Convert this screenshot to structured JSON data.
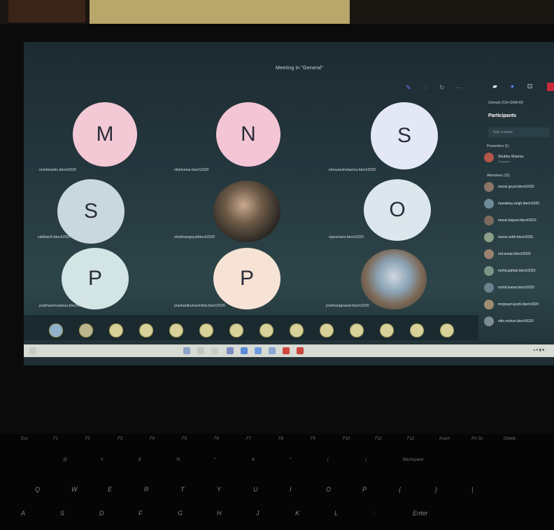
{
  "meeting": {
    "title": "Meeting in \"General\""
  },
  "tiles": [
    {
      "initial": "M",
      "type": "initial",
      "color": "#f3c9d6",
      "name": "mohitmahto.btech2020"
    },
    {
      "initial": "N",
      "type": "initial",
      "color": "#f4c5d4",
      "name": "nitinkumar.btech2020"
    },
    {
      "initial": "S",
      "type": "initial",
      "color": "#e4e8f6",
      "name": "shreyanshsharma.btech2020"
    },
    {
      "initial": "S",
      "type": "initial",
      "color": "#c9d8dd",
      "name": "siddharth.btech2020"
    },
    {
      "initial": "",
      "type": "photo",
      "color": "",
      "name": "shubhamgoyalbtech2020"
    },
    {
      "initial": "O",
      "type": "initial",
      "color": "#dbe7ec",
      "name": "ojasvisaini.btech2020"
    },
    {
      "initial": "P",
      "type": "initial",
      "color": "#d3e4e4",
      "name": "prakharsrivastava.btech2020"
    },
    {
      "initial": "P",
      "type": "initial",
      "color": "#f7e3d6",
      "name": "prashantkumarmittal.btech2020"
    },
    {
      "initial": "",
      "type": "photo2",
      "color": "",
      "name": "prakharagrawal.btech2020"
    }
  ],
  "panel": {
    "hint": "Unmute (Ctrl+Shift+M)",
    "title": "Participants",
    "search_placeholder": "Type a name",
    "presenters_label": "Presenters (1)",
    "presenter": {
      "name": "Shubha Sharma",
      "role": "Organizer"
    },
    "attendees_label": "Attendees (33)",
    "attendees": [
      "mansi.goyal.btech2020",
      "mandeep.singh.btech2020",
      "mansi.kapoor.btech2020",
      "manvi.sethi.btech2020",
      "md.ansari.btech2020",
      "mohit.pathak.btech2020",
      "mohit.kumar.btech2020",
      "mrignayni.joshi.btech2020",
      "nitin.mohan.btech2020"
    ]
  },
  "reaction_strip": {
    "count": 14
  },
  "keyboard": {
    "row1": [
      "Esc",
      "F1",
      "F2",
      "F3",
      "F4",
      "F5",
      "F6",
      "F7",
      "F8",
      "F9",
      "F10",
      "F11",
      "F12",
      "Insert",
      "Prt Sc",
      "Delete"
    ],
    "row2": [
      "@",
      "#",
      "$",
      "%",
      "^",
      "&",
      "*",
      "(",
      ")",
      "Backspace"
    ],
    "row3": [
      "Q",
      "W",
      "E",
      "R",
      "T",
      "Y",
      "U",
      "I",
      "O",
      "P",
      "{",
      "}",
      "|"
    ],
    "row4": [
      "A",
      "S",
      "D",
      "F",
      "G",
      "H",
      "J",
      "K",
      "L",
      ":",
      "Enter"
    ]
  },
  "colors": {
    "accent": "#6c7cf0",
    "leave": "#c9283a",
    "panel_bg": "#1f2e33",
    "avatar_text": "#2a2d3a"
  }
}
